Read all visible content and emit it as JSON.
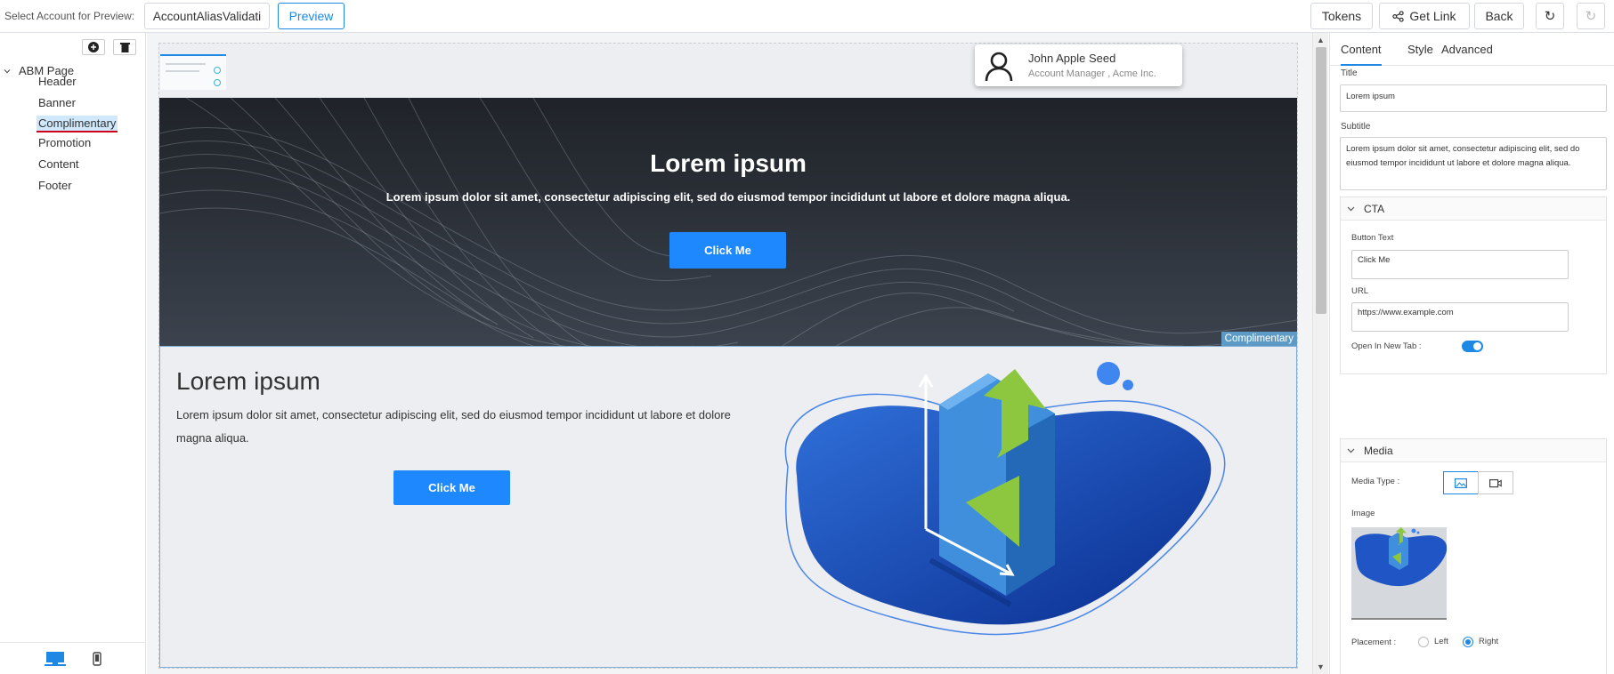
{
  "topbar": {
    "select_label": "Select Account for Preview:",
    "account_value": "AccountAliasValidati",
    "preview_label": "Preview",
    "tokens_label": "Tokens",
    "get_link_label": "Get Link",
    "back_label": "Back",
    "refresh_icon": "refresh-icon",
    "redo_icon": "redo-icon"
  },
  "tree": {
    "root": "ABM Page",
    "items": [
      {
        "label": "Header"
      },
      {
        "label": "Banner"
      },
      {
        "label": "Complimentary",
        "active": true
      },
      {
        "label": "Promotion"
      },
      {
        "label": "Content"
      },
      {
        "label": "Footer"
      }
    ]
  },
  "preview": {
    "user_card": {
      "name": "John Apple Seed",
      "role": "Account Manager , Acme Inc."
    },
    "banner": {
      "title": "Lorem ipsum",
      "subtitle": "Lorem ipsum dolor sit amet, consectetur adipiscing elit, sed do eiusmod tempor incididunt ut labore et dolore magna aliqua.",
      "button": "Click Me",
      "section_tag": "Complimentary"
    },
    "complimentary": {
      "title": "Lorem ipsum",
      "subtitle": "Lorem ipsum dolor sit amet, consectetur adipiscing elit, sed do eiusmod tempor incididunt ut labore et dolore magna aliqua.",
      "button": "Click Me"
    }
  },
  "props": {
    "tabs": [
      "Content",
      "Style",
      "Advanced"
    ],
    "active_tab": "Content",
    "title_label": "Title",
    "title_value": "Lorem ipsum",
    "subtitle_label": "Subtitle",
    "subtitle_value": "Lorem ipsum dolor sit amet, consectetur adipiscing elit, sed do eiusmod tempor incididunt ut labore et dolore magna aliqua.",
    "cta": {
      "heading": "CTA",
      "button_text_label": "Button Text",
      "button_text_value": "Click Me",
      "url_label": "URL",
      "url_value": "https://www.example.com",
      "new_tab_label": "Open In New Tab :",
      "new_tab_on": true
    },
    "media": {
      "heading": "Media",
      "type_label": "Media Type :",
      "image_label": "Image",
      "placement_label": "Placement :",
      "left_label": "Left",
      "right_label": "Right",
      "placement": "Right"
    }
  },
  "colors": {
    "accent": "#1e88e5",
    "cta": "#1e88ff",
    "active_underline": "#d0021b"
  }
}
